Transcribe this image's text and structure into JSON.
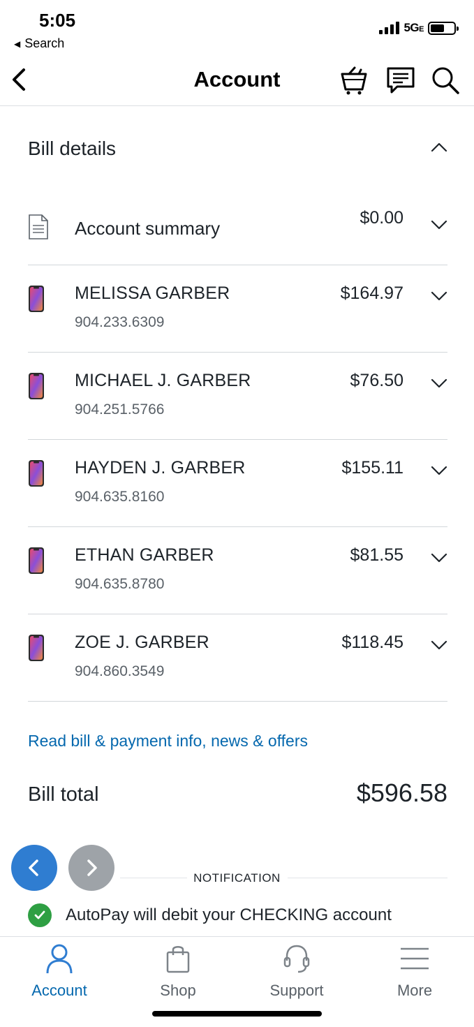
{
  "status_bar": {
    "time": "5:05",
    "back_label": "Search",
    "network": "5G",
    "network_suffix": "E",
    "battery_level": 0.6
  },
  "nav": {
    "title": "Account",
    "icons": [
      "back-chevron-icon",
      "shopping-basket-icon",
      "chat-icon",
      "search-icon"
    ]
  },
  "bill_details": {
    "title": "Bill details",
    "summary": {
      "label": "Account summary",
      "amount": "$0.00"
    },
    "lines": [
      {
        "name": "MELISSA GARBER",
        "phone": "904.233.6309",
        "amount": "$164.97"
      },
      {
        "name": "MICHAEL J. GARBER",
        "phone": "904.251.5766",
        "amount": "$76.50"
      },
      {
        "name": "HAYDEN J. GARBER",
        "phone": "904.635.8160",
        "amount": "$155.11"
      },
      {
        "name": "ETHAN GARBER",
        "phone": "904.635.8780",
        "amount": "$81.55"
      },
      {
        "name": "ZOE J. GARBER",
        "phone": "904.860.3549",
        "amount": "$118.45"
      }
    ],
    "link": "Read bill & payment info, news & offers",
    "total_label": "Bill total",
    "total_value": "$596.58"
  },
  "notification": {
    "label": "NOTIFICATION",
    "text": "AutoPay will debit your CHECKING account"
  },
  "tabs": [
    {
      "label": "Account",
      "icon": "person-icon",
      "active": true
    },
    {
      "label": "Shop",
      "icon": "shopping-bag-icon",
      "active": false
    },
    {
      "label": "Support",
      "icon": "headset-icon",
      "active": false
    },
    {
      "label": "More",
      "icon": "menu-icon",
      "active": false
    }
  ],
  "colors": {
    "link": "#0568ae",
    "carousel_active": "#2f7dd1",
    "carousel_inactive": "#9ea3a8",
    "success": "#2e9f43",
    "text": "#1d2329"
  }
}
